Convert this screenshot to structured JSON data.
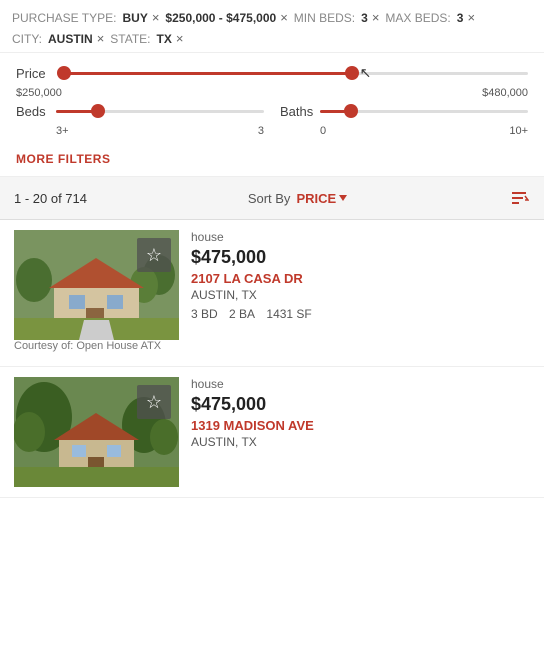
{
  "filters": {
    "tags": [
      {
        "id": "purchase-type",
        "label": "PURCHASE TYPE:",
        "value": "BUY"
      },
      {
        "id": "price-range",
        "label": "",
        "value": "$250,000 - $475,000"
      },
      {
        "id": "min-beds",
        "label": "MIN BEDS:",
        "value": "3"
      },
      {
        "id": "max-beds",
        "label": "MAX BEDS:",
        "value": "3"
      },
      {
        "id": "city",
        "label": "CITY:",
        "value": "AUSTIN"
      },
      {
        "id": "state",
        "label": "STATE:",
        "value": "TX"
      }
    ]
  },
  "sliders": {
    "price": {
      "label": "Price",
      "min": "$250,000",
      "max": "$480,000",
      "low_pct": 0,
      "high_pct": 62
    },
    "beds": {
      "label": "Beds",
      "min": "3+",
      "max": "3",
      "thumb_pct": 20
    },
    "baths": {
      "label": "Baths",
      "min": "0",
      "max": "10+",
      "thumb_pct": 15
    }
  },
  "more_filters_label": "MORE FILTERS",
  "results": {
    "count_text": "1 - 20 of 714",
    "sort_label": "Sort By",
    "sort_value": "PRICE"
  },
  "listings": [
    {
      "id": "listing-1",
      "type": "house",
      "price": "$475,000",
      "address": "2107 LA CASA DR",
      "city_state": "AUSTIN, TX",
      "beds": "3 BD",
      "baths": "2 BA",
      "sqft": "1431 SF",
      "courtesy": "Courtesy of: Open House ATX"
    },
    {
      "id": "listing-2",
      "type": "house",
      "price": "$475,000",
      "address": "1319 MADISON AVE",
      "city_state": "AUSTIN, TX",
      "beds": "",
      "baths": "",
      "sqft": ""
    }
  ],
  "icons": {
    "close": "×",
    "star": "☆",
    "sort": "↕"
  }
}
